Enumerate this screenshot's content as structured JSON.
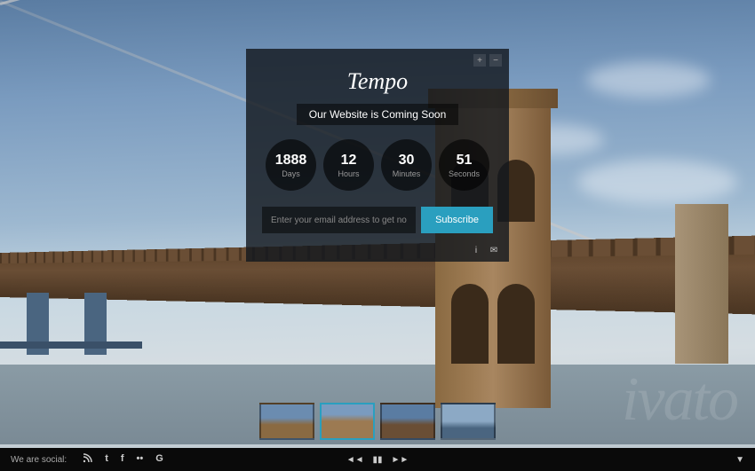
{
  "logo": "Tempo",
  "tagline": "Our Website is Coming Soon",
  "countdown": {
    "days": {
      "value": "1888",
      "label": "Days"
    },
    "hours": {
      "value": "12",
      "label": "Hours"
    },
    "minutes": {
      "value": "30",
      "label": "Minutes"
    },
    "seconds": {
      "value": "51",
      "label": "Seconds"
    }
  },
  "subscribe": {
    "placeholder": "Enter your email address to get notified",
    "button": "Subscribe"
  },
  "card_controls": {
    "expand": "+",
    "collapse": "−"
  },
  "card_footer": {
    "info": "i",
    "mail": "✉"
  },
  "footer": {
    "social_label": "We are social:",
    "rss": "►",
    "twitter": "t",
    "facebook": "f",
    "flickr": "••",
    "google": "G"
  },
  "player": {
    "prev": "◄◄",
    "pause": "▮▮",
    "next": "►►",
    "toggle": "▼"
  },
  "watermark": "ivato"
}
